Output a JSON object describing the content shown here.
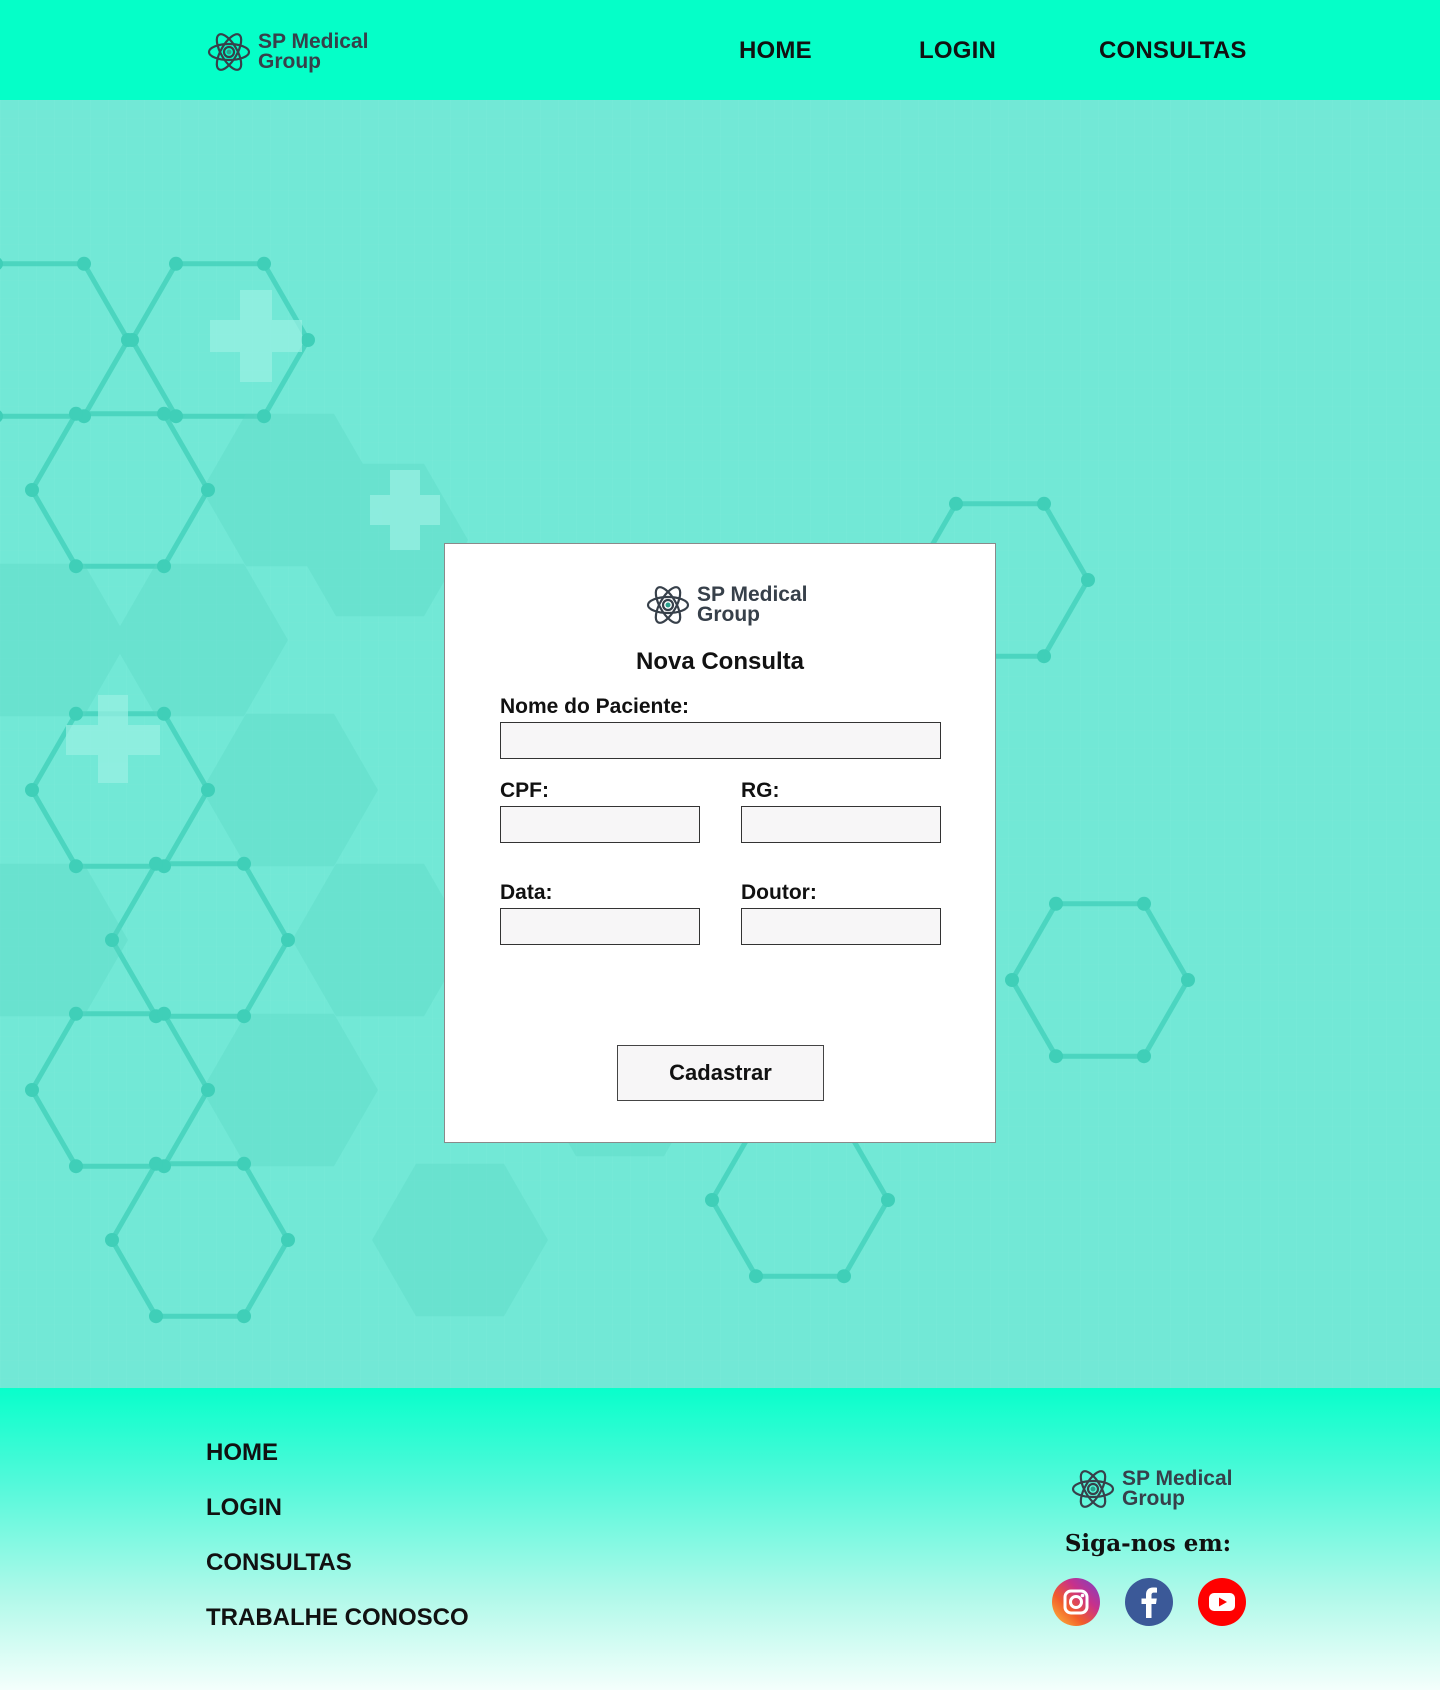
{
  "brand": {
    "line1": "SP Medical",
    "line2": "Group"
  },
  "header": {
    "nav": {
      "home": "HOME",
      "login": "LOGIN",
      "consultas": "CONSULTAS"
    }
  },
  "form": {
    "title": "Nova Consulta",
    "fields": {
      "nome_paciente": {
        "label": "Nome do Paciente:",
        "value": ""
      },
      "cpf": {
        "label": "CPF:",
        "value": ""
      },
      "rg": {
        "label": "RG:",
        "value": ""
      },
      "data": {
        "label": "Data:",
        "value": ""
      },
      "doutor": {
        "label": "Doutor:",
        "value": ""
      }
    },
    "submit_label": "Cadastrar"
  },
  "footer": {
    "links": {
      "home": "HOME",
      "login": "LOGIN",
      "consultas": "CONSULTAS",
      "trabalhe": "TRABALHE CONOSCO"
    },
    "follow_label": "Siga-nos em:",
    "social_icons": [
      "instagram-icon",
      "facebook-icon",
      "youtube-icon"
    ]
  },
  "colors": {
    "header_bg": "#05ffc8",
    "hero_bg": "#72e8d6",
    "hex_stroke": "#3fcfb8",
    "instagram": "#c8318b",
    "facebook": "#3b5998",
    "youtube": "#ff0000"
  }
}
